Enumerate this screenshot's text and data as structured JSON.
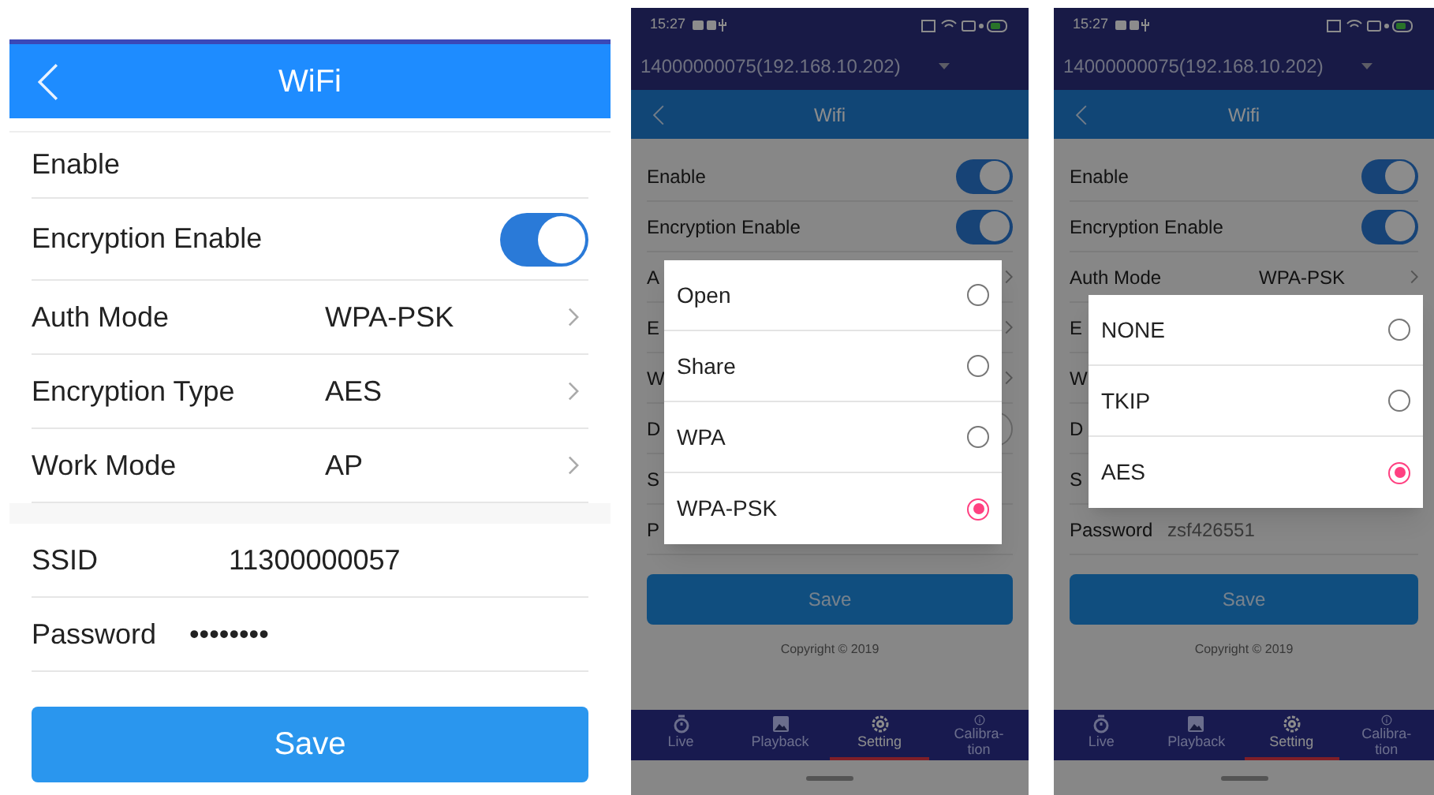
{
  "screens": [
    {
      "kind": "plain",
      "title": "WiFi",
      "rows": [
        {
          "kind": "label",
          "label": "Enable"
        },
        {
          "kind": "toggle",
          "label": "Encryption Enable",
          "on": true
        },
        {
          "kind": "select",
          "label": "Auth Mode",
          "value": "WPA-PSK"
        },
        {
          "kind": "select",
          "label": "Encryption Type",
          "value": "AES"
        },
        {
          "kind": "select",
          "label": "Work Mode",
          "value": "AP"
        },
        {
          "kind": "gap"
        },
        {
          "kind": "text",
          "label": "SSID",
          "value": "11300000057"
        },
        {
          "kind": "password",
          "label": "Password",
          "value": "••••••••"
        }
      ],
      "save": "Save"
    },
    {
      "kind": "dialog",
      "time": "15:27",
      "device": "14000000075(192.168.10.202)",
      "title": "Wifi",
      "rows": [
        {
          "kind": "toggle",
          "label": "Enable",
          "on": true
        },
        {
          "kind": "toggle",
          "label": "Encryption Enable",
          "on": true
        },
        {
          "kind": "select",
          "label": "A"
        },
        {
          "kind": "select",
          "label": "E"
        },
        {
          "kind": "select",
          "label": "W"
        },
        {
          "kind": "toggle",
          "label": "D",
          "on": false
        },
        {
          "kind": "text",
          "label": "S"
        },
        {
          "kind": "text",
          "label": "P"
        }
      ],
      "save": "Save",
      "copyright": "Copyright © 2019",
      "nav": [
        {
          "label": "Live",
          "selected": false
        },
        {
          "label": "Playback",
          "selected": false
        },
        {
          "label": "Setting",
          "selected": true
        },
        {
          "label": "Calibra-tion",
          "selected": false
        }
      ],
      "options": [
        {
          "label": "Open",
          "selected": false
        },
        {
          "label": "Share",
          "selected": false
        },
        {
          "label": "WPA",
          "selected": false
        },
        {
          "label": "WPA-PSK",
          "selected": true
        }
      ]
    },
    {
      "kind": "dialog",
      "time": "15:27",
      "device": "14000000075(192.168.10.202)",
      "title": "Wifi",
      "rows": [
        {
          "kind": "toggle",
          "label": "Enable",
          "on": true
        },
        {
          "kind": "toggle",
          "label": "Encryption Enable",
          "on": true
        },
        {
          "kind": "select",
          "label": "Auth Mode",
          "value": "WPA-PSK"
        },
        {
          "kind": "select",
          "label": "E"
        },
        {
          "kind": "select",
          "label": "W"
        },
        {
          "kind": "label",
          "label": "D"
        },
        {
          "kind": "text",
          "label": "S"
        },
        {
          "kind": "text",
          "label": "Password",
          "value": "zsf426551"
        }
      ],
      "save": "Save",
      "copyright": "Copyright © 2019",
      "nav": [
        {
          "label": "Live",
          "selected": false
        },
        {
          "label": "Playback",
          "selected": false
        },
        {
          "label": "Setting",
          "selected": true
        },
        {
          "label": "Calibra-tion",
          "selected": false
        }
      ],
      "options": [
        {
          "label": "NONE",
          "selected": false
        },
        {
          "label": "TKIP",
          "selected": false
        },
        {
          "label": "AES",
          "selected": true
        }
      ]
    }
  ]
}
